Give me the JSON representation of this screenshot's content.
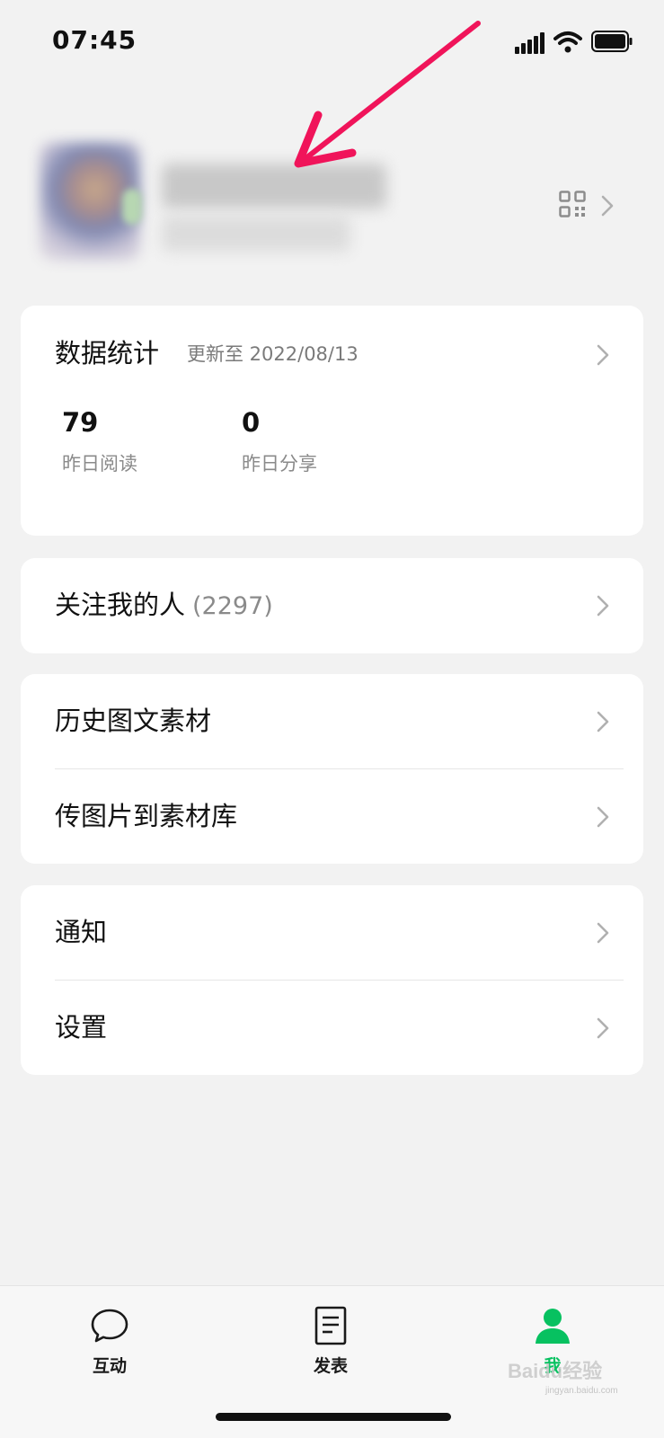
{
  "status_bar": {
    "time": "07:45",
    "icons": [
      "signal-icon",
      "wifi-icon",
      "battery-icon"
    ]
  },
  "profile": {
    "account_name": "",
    "account_sub": "",
    "icons": [
      "qr-code-icon",
      "chevron-right-icon"
    ]
  },
  "annotation": {
    "arrow_color": "#f0145a"
  },
  "stats": {
    "title": "数据统计",
    "updated": "更新至 2022/08/13",
    "items": [
      {
        "value": "79",
        "label": "昨日阅读"
      },
      {
        "value": "0",
        "label": "昨日分享"
      }
    ]
  },
  "followers": {
    "label": "关注我的人",
    "count": "(2297)"
  },
  "materials": {
    "items": [
      {
        "label": "历史图文素材"
      },
      {
        "label": "传图片到素材库"
      }
    ]
  },
  "misc": {
    "items": [
      {
        "label": "通知"
      },
      {
        "label": "设置"
      }
    ]
  },
  "tab_bar": {
    "tabs": [
      {
        "label": "互动",
        "icon": "chat-bubble-icon",
        "active": false
      },
      {
        "label": "发表",
        "icon": "document-icon",
        "active": false
      },
      {
        "label": "我",
        "icon": "person-icon",
        "active": true
      }
    ],
    "active_color": "#07c160"
  },
  "watermark": {
    "text": "Baidu经验",
    "sub": "jingyan.baidu.com"
  }
}
